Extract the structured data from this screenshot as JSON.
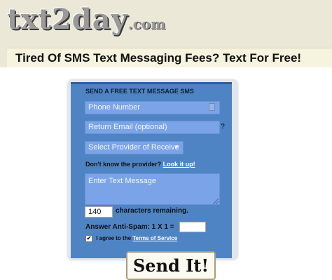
{
  "logo": {
    "name": "txt2day",
    "suffix": ".com"
  },
  "tagline": "Tired Of SMS Text Messaging Fees? Text For Free!",
  "form": {
    "title": "SEND A FREE TEXT MESSAGE SMS",
    "phone_placeholder": "Phone Number",
    "email_placeholder": "Return Email (optional)",
    "email_help": "?",
    "provider_selected": "Select Provider of Receive",
    "provider_arrow": "▾",
    "dont_know": "Don't know the provider?",
    "look_it_up": "Look it up!",
    "message_placeholder": "Enter Text Message",
    "char_count": "140",
    "char_label": "characters remaining.",
    "antispam_label": "Answer Anti-Spam: 1 X 1 =",
    "agree_prefix": "I agree to the",
    "terms_link": "Terms of Service",
    "agree_checked": "✔",
    "send_label": "Send It!"
  },
  "colors": {
    "form_bg": "#4e84c4",
    "field_bg": "#7aa3e8",
    "page_bg": "#ece8d7"
  },
  "icons": [
    "phone-book-icon",
    "resize-handle-icon",
    "dropdown-arrow-icon",
    "checkbox-check-icon"
  ]
}
